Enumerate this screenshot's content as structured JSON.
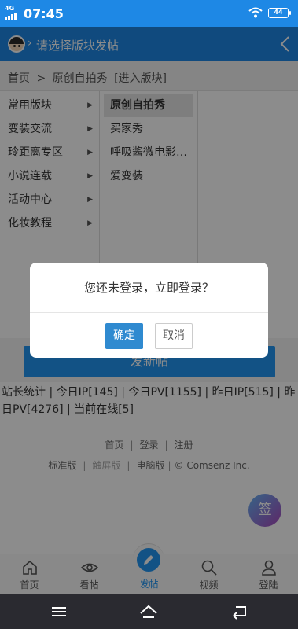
{
  "statusbar": {
    "network": "4G",
    "time": "07:45",
    "battery": "44"
  },
  "header": {
    "title": "请选择版块发帖",
    "back_icon": "chevron-left-icon"
  },
  "breadcrumb": {
    "home": "首页",
    "sep": ">",
    "forum": "原创自拍秀",
    "enter": "[进入版块]"
  },
  "menu": {
    "categories": [
      "常用版块",
      "变装交流",
      "玲距离专区",
      "小说连载",
      "活动中心",
      "化妆教程"
    ],
    "forums": [
      "原创自拍秀",
      "买家秀",
      "呼吸酱微电影…",
      "爱变装"
    ]
  },
  "newpost": {
    "label": "发新帖"
  },
  "stats": {
    "text": "站长统计 | 今日IP[145] | 今日PV[1155] | 昨日IP[515] | 昨日PV[4276] | 当前在线[5]"
  },
  "footer": {
    "links": [
      "首页",
      "登录",
      "注册"
    ],
    "standard": "标准版",
    "touch": "触屏版",
    "pc": "电脑版",
    "copyright": "© Comsenz Inc."
  },
  "fab": {
    "label": "签"
  },
  "tabbar": {
    "items": [
      {
        "label": "首页",
        "icon": "home-icon"
      },
      {
        "label": "看帖",
        "icon": "eye-icon"
      },
      {
        "label": "发帖",
        "icon": "pencil-icon"
      },
      {
        "label": "视频",
        "icon": "search-icon"
      },
      {
        "label": "登陆",
        "icon": "user-icon"
      }
    ]
  },
  "dialog": {
    "message": "您还未登录，立即登录？",
    "ok": "确定",
    "cancel": "取消"
  },
  "colors": {
    "primary": "#1e88e5",
    "button": "#2f8ad0",
    "navbar": "#2a2a30"
  }
}
